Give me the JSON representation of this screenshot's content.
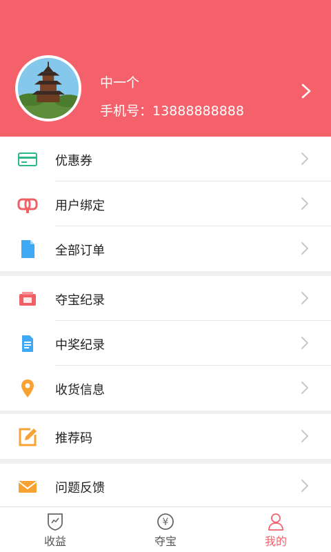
{
  "profile": {
    "name": "中一个",
    "phone": "手机号：13888888888"
  },
  "menu_groups": [
    [
      {
        "label": "优惠券",
        "icon": "coupon-card-icon",
        "color": "#2bb98a"
      },
      {
        "label": "用户绑定",
        "icon": "link-bind-icon",
        "color": "#f06064"
      },
      {
        "label": "全部订单",
        "icon": "document-icon",
        "color": "#3fa9f5"
      }
    ],
    [
      {
        "label": "夺宝纪录",
        "icon": "treasure-card-icon",
        "color": "#f06064"
      },
      {
        "label": "中奖纪录",
        "icon": "file-list-icon",
        "color": "#3fa9f5"
      },
      {
        "label": "收货信息",
        "icon": "location-pin-icon",
        "color": "#f7a233"
      }
    ],
    [
      {
        "label": "推荐码",
        "icon": "edit-icon",
        "color": "#f7a233"
      }
    ],
    [
      {
        "label": "问题反馈",
        "icon": "mail-icon",
        "color": "#f7a233"
      }
    ]
  ],
  "tabbar": {
    "tabs": [
      {
        "label": "收益",
        "icon": "earnings-shield-icon",
        "active": false
      },
      {
        "label": "夺宝",
        "icon": "yen-coin-icon",
        "active": false
      },
      {
        "label": "我的",
        "icon": "user-icon",
        "active": true
      }
    ],
    "coin_symbol": "¥"
  },
  "colors": {
    "header": "#f4616a",
    "active_tab": "#f4616a"
  }
}
